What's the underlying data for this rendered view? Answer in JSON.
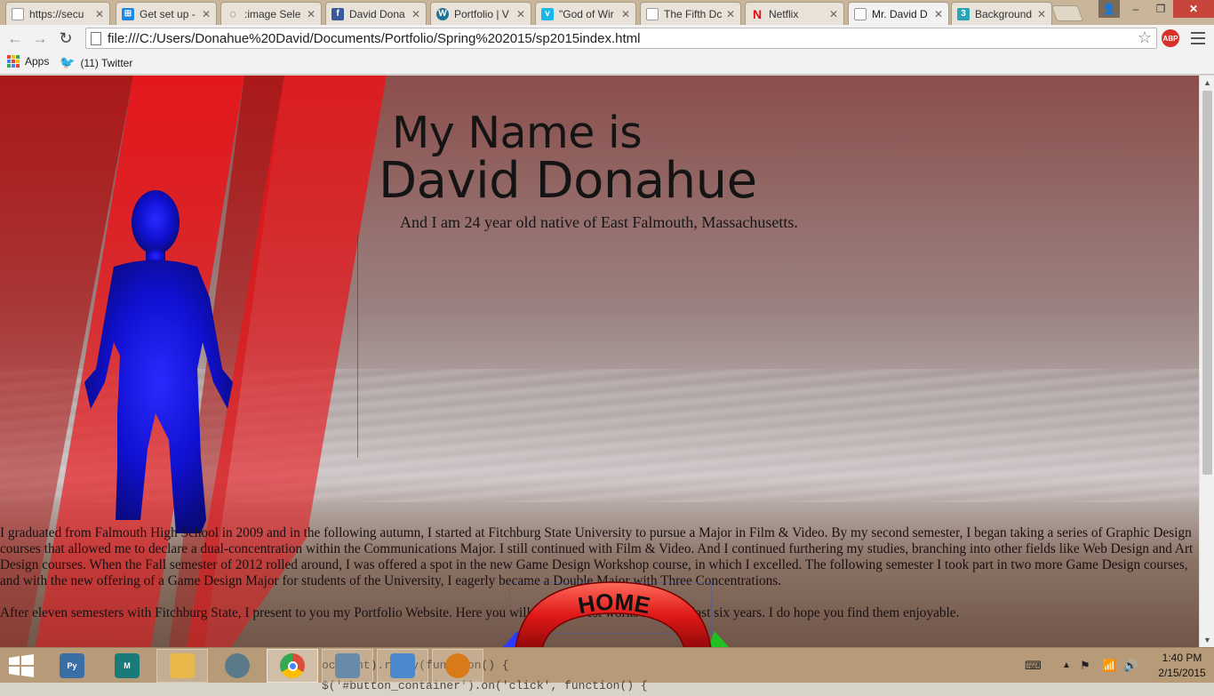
{
  "browser": {
    "tabs": [
      {
        "title": "https://secu",
        "favicon": "page-icon",
        "color": "#888888",
        "active": false
      },
      {
        "title": "Get set up -",
        "favicon": "windows-icon",
        "color": "#1e88e5",
        "active": false
      },
      {
        "title": ":image Sele",
        "favicon": "loading-icon",
        "color": "#555555",
        "active": false
      },
      {
        "title": "David Dona",
        "favicon": "facebook-icon",
        "color": "#3b5998",
        "active": false
      },
      {
        "title": "Portfolio | V",
        "favicon": "wordpress-icon",
        "color": "#21759b",
        "active": false
      },
      {
        "title": "\"God of Wir",
        "favicon": "vimeo-icon",
        "color": "#1ab7ea",
        "active": false
      },
      {
        "title": "The Fifth Dc",
        "favicon": "page-icon",
        "color": "#888888",
        "active": false
      },
      {
        "title": "Netflix",
        "favicon": "netflix-icon",
        "color": "#e50914",
        "active": false
      },
      {
        "title": "Mr. David D",
        "favicon": "page-icon",
        "color": "#888888",
        "active": true
      },
      {
        "title": "Background",
        "favicon": "three-icon",
        "color": "#2aa3b8",
        "active": false
      }
    ],
    "url": "file:///C:/Users/Donahue%20David/Documents/Portfolio/Spring%202015/sp2015index.html",
    "bookmarks": [
      {
        "label": "Apps",
        "icon": "apps-grid-icon"
      },
      {
        "label": "(11) Twitter",
        "icon": "twitter-icon"
      }
    ],
    "abp_label": "ABP"
  },
  "page": {
    "title_line1": "My Name is",
    "title_line2": "David Donahue",
    "subtitle": "And I am 24 year old native of East Falmouth, Massachusetts.",
    "bio_paragraphs": [
      "I graduated from Falmouth High School in 2009 and in the following autumn, I started at Fitchburg State University to pursue a Major in Film & Video. By my second semester, I began taking a series of Graphic Design courses that allowed me to declare a dual-concentration within the Communications Major. I still continued with Film & Video. And I continued furthering my studies, branching into other fields like Web Design and Art Design courses. When the Fall semester of 2012 rolled around, I was offered a spot in the new Game Design Workshop course, in which I excelled. The following semester I took part in two more Game Design courses, and with the new offering of a Game Design Major for students of the University, I eagerly became a Double Major with Three Concentrations.",
      "After eleven semesters with Fitchburg State, I present to you my Portfolio Website. Here you will find my best works from the last six years. I do hope you find them enjoyable."
    ],
    "home_button_label": "HOME",
    "colors": {
      "silhouette": "#1010e0",
      "spotlight": "#e8151a",
      "home_button": "#e01818"
    }
  },
  "taskbar": {
    "apps": [
      {
        "name": "python-icon",
        "color": "#3a6ea5"
      },
      {
        "name": "maya-icon",
        "color": "#1a7a7a"
      },
      {
        "name": "file-explorer-icon",
        "color": "#e8b84a"
      },
      {
        "name": "network-icon",
        "color": "#5a7a8a"
      },
      {
        "name": "chrome-icon",
        "color": "#dd4b39"
      },
      {
        "name": "monitor-app-icon",
        "color": "#6a8aaa"
      },
      {
        "name": "notepad-app-icon",
        "color": "#4a8acc"
      },
      {
        "name": "media-player-icon",
        "color": "#d87a1a"
      }
    ],
    "code_line1": "ocument).ready(function() {",
    "code_line2": "$('#button_container').on('click', function() {",
    "time": "1:40 PM",
    "date": "2/15/2015"
  }
}
